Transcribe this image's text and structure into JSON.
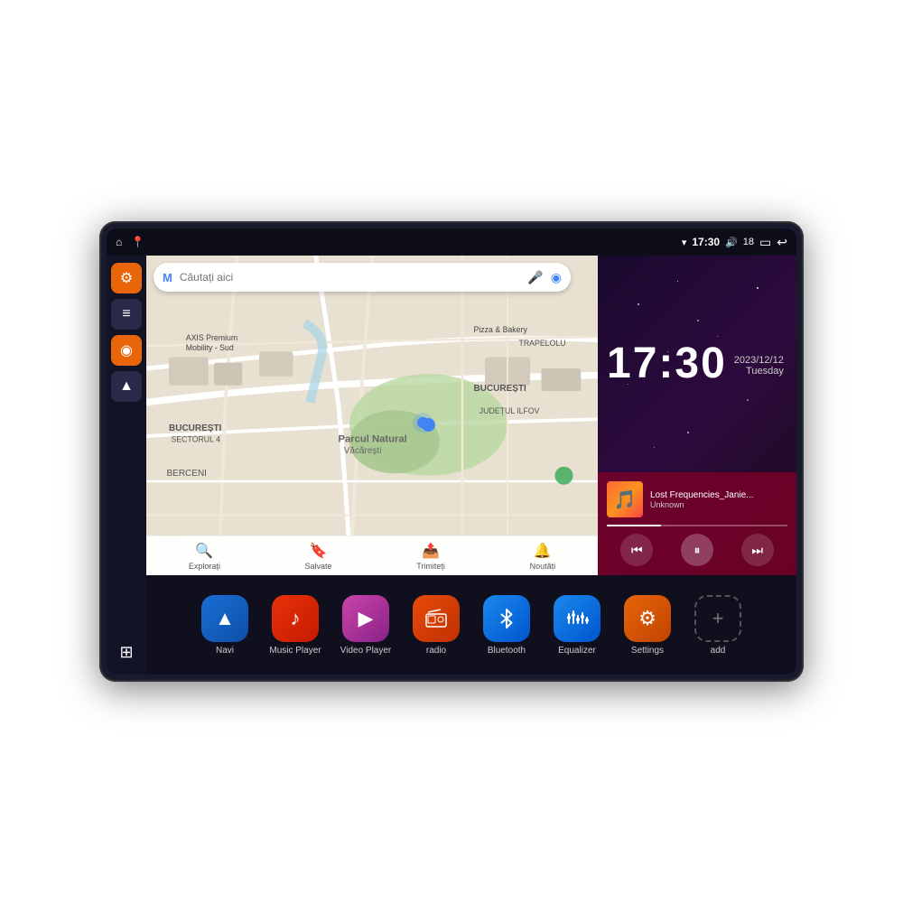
{
  "device": {
    "status_bar": {
      "left_icons": [
        "home",
        "map-pin"
      ],
      "time": "17:30",
      "signal_icon": "▾",
      "volume_icon": "🔊",
      "battery_level": "18",
      "battery_icon": "▭",
      "back_icon": "↩"
    },
    "sidebar": {
      "buttons": [
        {
          "id": "settings",
          "icon": "⚙",
          "color": "orange"
        },
        {
          "id": "file",
          "icon": "≡",
          "color": "dark"
        },
        {
          "id": "map",
          "icon": "◉",
          "color": "orange"
        },
        {
          "id": "nav",
          "icon": "▲",
          "color": "dark"
        },
        {
          "id": "grid",
          "icon": "⊞",
          "color": "grid"
        }
      ]
    },
    "map": {
      "search_placeholder": "Căutați aici",
      "locations": [
        "AXIS Premium Mobility - Sud",
        "Pizza & Bakery",
        "Parcul Natural Văcărești",
        "BUCUREȘTI",
        "BUCUREȘTI SECTORUL 4",
        "JUDEȚUL ILFOV",
        "BERCENI"
      ],
      "bottom_nav": [
        {
          "label": "Explorați",
          "icon": "🔍"
        },
        {
          "label": "Salvate",
          "icon": "🔖"
        },
        {
          "label": "Trimiteți",
          "icon": "📤"
        },
        {
          "label": "Noutăți",
          "icon": "🔔"
        }
      ]
    },
    "clock": {
      "time": "17:30",
      "date": "2023/12/12",
      "day": "Tuesday"
    },
    "music": {
      "title": "Lost Frequencies_Janie...",
      "artist": "Unknown",
      "progress": 30,
      "controls": {
        "prev": "⏮",
        "play_pause": "⏸",
        "next": "⏭"
      }
    },
    "apps": [
      {
        "id": "navi",
        "label": "Navi",
        "icon": "▲",
        "color": "navi"
      },
      {
        "id": "music-player",
        "label": "Music Player",
        "icon": "♪",
        "color": "music"
      },
      {
        "id": "video-player",
        "label": "Video Player",
        "icon": "▶",
        "color": "video"
      },
      {
        "id": "radio",
        "label": "radio",
        "icon": "📻",
        "color": "radio"
      },
      {
        "id": "bluetooth",
        "label": "Bluetooth",
        "icon": "⚡",
        "color": "bluetooth"
      },
      {
        "id": "equalizer",
        "label": "Equalizer",
        "icon": "≡",
        "color": "equalizer"
      },
      {
        "id": "settings",
        "label": "Settings",
        "icon": "⚙",
        "color": "settings"
      },
      {
        "id": "add",
        "label": "add",
        "icon": "+",
        "color": "add-app"
      }
    ]
  }
}
